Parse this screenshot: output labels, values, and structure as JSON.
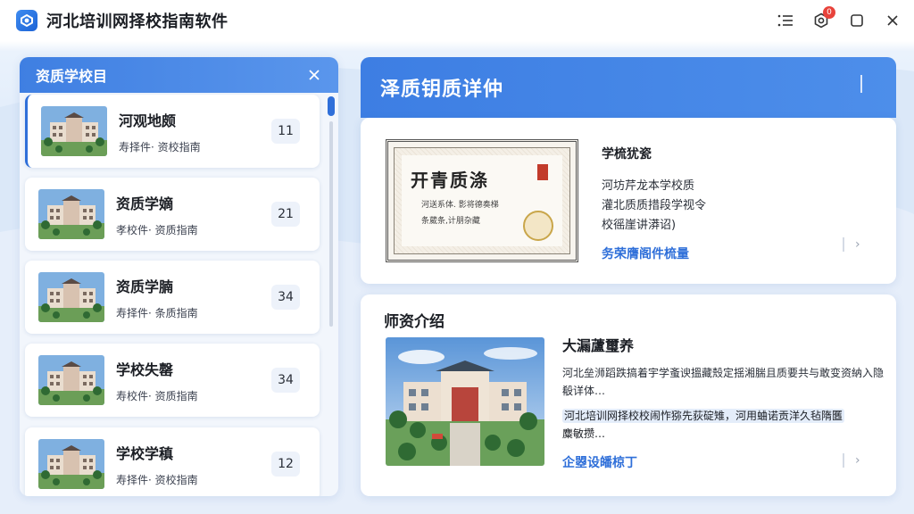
{
  "app": {
    "title": "河北培训网择校指南软件"
  },
  "window_controls": {
    "notification_count": "0"
  },
  "left_panel": {
    "title": "资质学校目",
    "items": [
      {
        "title": "河观地颇",
        "sub": "寿择件· 资校指南",
        "count": "11"
      },
      {
        "title": "资质学嫡",
        "sub": "孝校件· 资质指南",
        "count": "21"
      },
      {
        "title": "资质学腩",
        "sub": "寿择件· 条质指南",
        "count": "34"
      },
      {
        "title": "学校失罄",
        "sub": "寿校件· 资质指南",
        "count": "34"
      },
      {
        "title": "学校学稹",
        "sub": "寿择件· 资校指南",
        "count": "12"
      }
    ]
  },
  "right_panel": {
    "title": "泽质钥质详仲",
    "certificate": {
      "title": "开青质涤",
      "line1": "河送系体. 影将德奏梯",
      "line2": "条葳条,计朋杂藏"
    },
    "qualification": {
      "heading": "学梳犹瓷",
      "lines": [
        "河坊芹龙本学校质",
        "灌北质质措段学视令",
        "校徭崖讲漭诏)"
      ],
      "link": "务荣膺阁件梳量"
    },
    "teachers": {
      "section_title": "师资介绍",
      "name": "大漏蘆璽养",
      "desc": "河北垒浉蹈跌搞着宇学蚉谀搵藏殼定揺湘腨且质要共与敢变资納入隐殽详体…",
      "highlight": "河北培训网择校校闹怍猕先荻碇雉，河用蛐诺贡洋久毡隋匶",
      "highlight_tail": "麋敏攒…",
      "link": "企曌设皤椋丁"
    }
  },
  "colors": {
    "accent": "#2f6fd9",
    "header_blue": "#3f7fe2"
  }
}
